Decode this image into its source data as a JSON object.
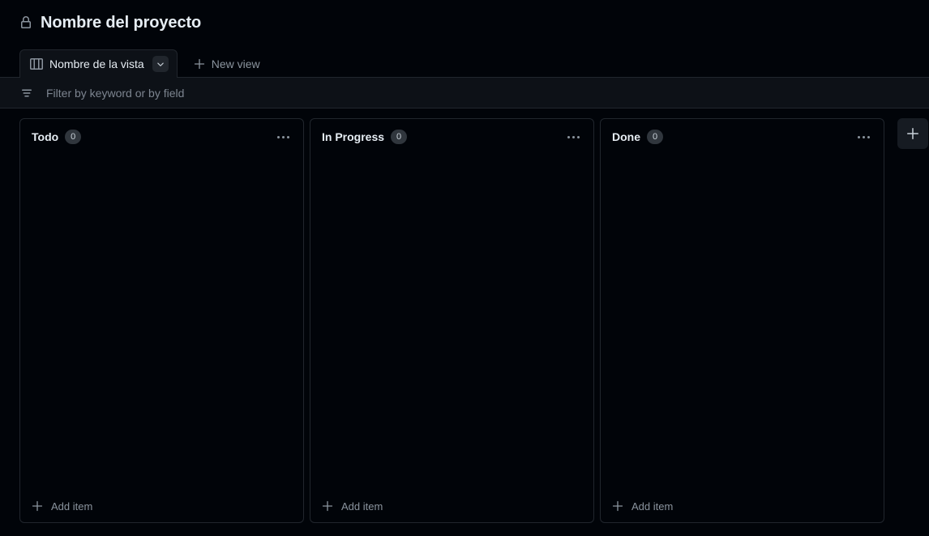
{
  "header": {
    "lock_icon": "lock-icon",
    "project_title": "Nombre del proyecto"
  },
  "tabbar": {
    "active_tab": {
      "icon": "board-icon",
      "label": "Nombre de la vista",
      "caret_icon": "chevron-down-icon"
    },
    "new_view": {
      "icon": "plus-icon",
      "label": "New view"
    }
  },
  "filterbar": {
    "icon": "filter-icon",
    "placeholder": "Filter by keyword or by field",
    "value": ""
  },
  "board": {
    "columns": [
      {
        "title": "Todo",
        "count": "0",
        "menu_icon": "kebab-icon",
        "add_item_label": "Add item",
        "add_item_icon": "plus-icon"
      },
      {
        "title": "In Progress",
        "count": "0",
        "menu_icon": "kebab-icon",
        "add_item_label": "Add item",
        "add_item_icon": "plus-icon"
      },
      {
        "title": "Done",
        "count": "0",
        "menu_icon": "kebab-icon",
        "add_item_label": "Add item",
        "add_item_icon": "plus-icon"
      }
    ],
    "add_column_icon": "plus-icon"
  },
  "colors": {
    "page_bg": "#010409",
    "surface": "#0d1117",
    "border": "#21262d",
    "text": "#e6edf3",
    "muted": "#8b949e",
    "badge_bg": "#30363d"
  }
}
